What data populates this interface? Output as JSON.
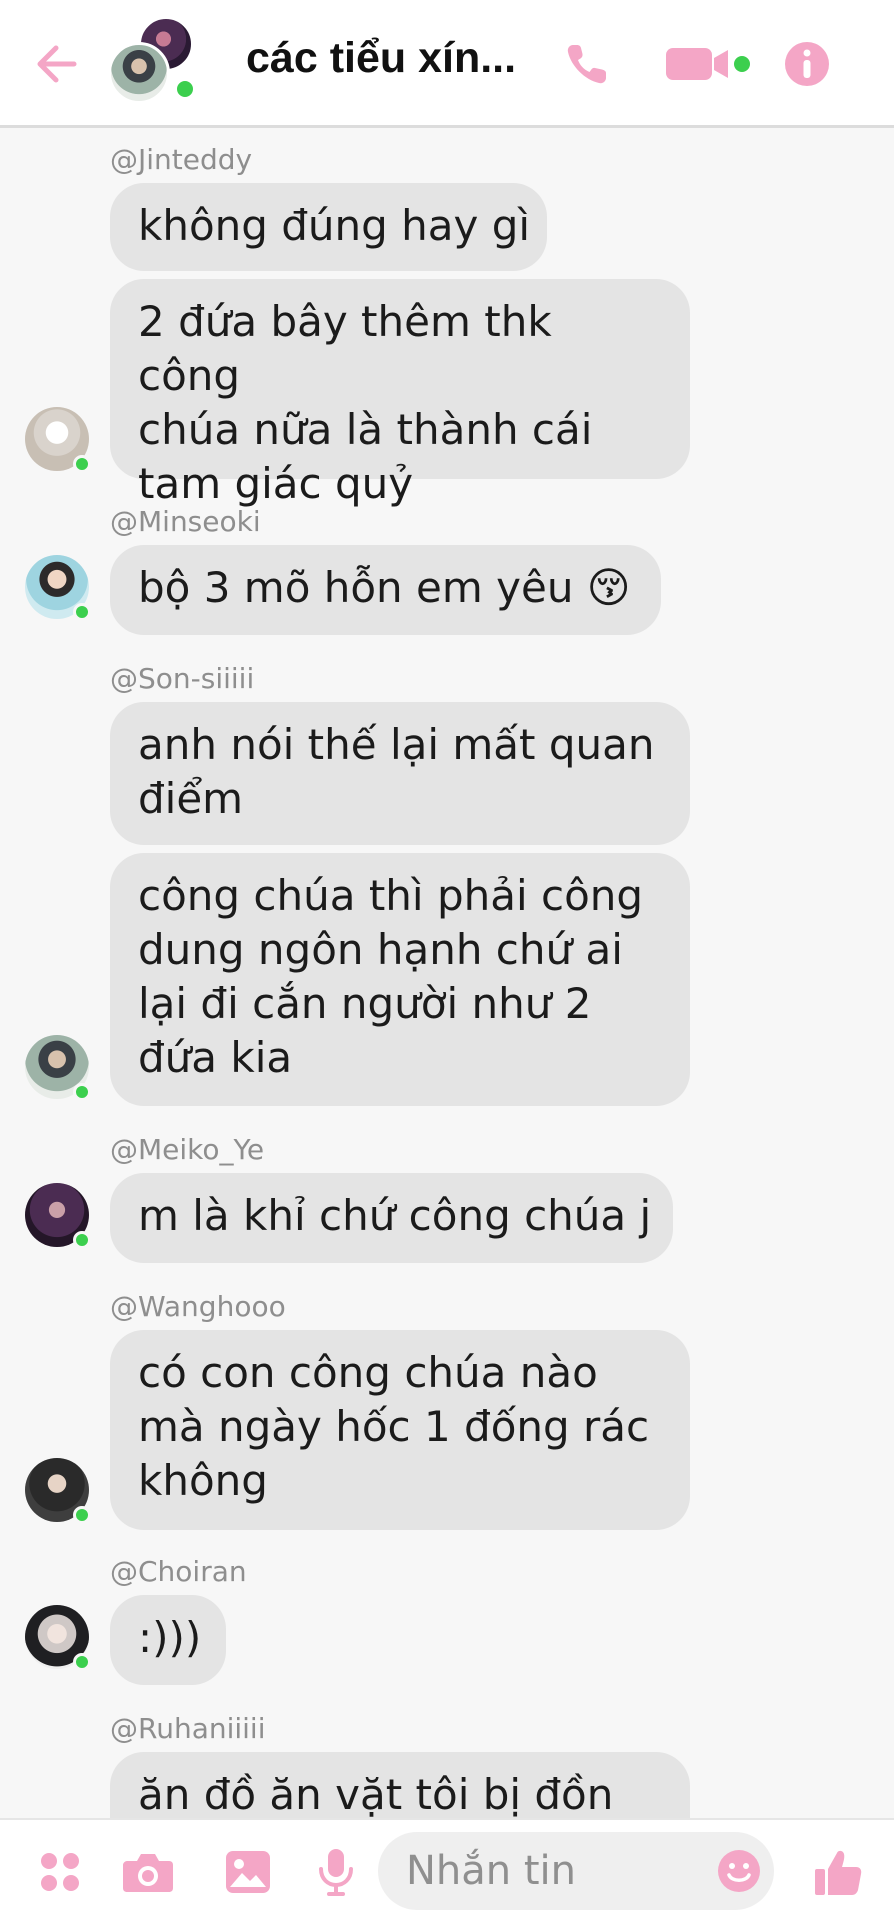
{
  "header": {
    "title": "các tiểu xín..."
  },
  "colors": {
    "accent": "#f4a6c6",
    "online": "#3ccf4e",
    "bubble": "#e4e4e4"
  },
  "messages": [
    {
      "sender": "@Jinteddy",
      "bubbles": [
        "không đúng hay gì",
        "2 đứa bây thêm thk công\nchúa nữa là thành cái\ntam giác quỷ"
      ]
    },
    {
      "sender": "@Minseoki",
      "bubbles": [
        "bộ 3 mõ hỗn em yêu 😚"
      ]
    },
    {
      "sender": "@Son-siiiii",
      "bubbles": [
        "anh nói thế lại mất quan\nđiểm",
        "công chúa thì phải công\ndung ngôn hạnh chứ ai\nlại đi cắn người như 2\nđứa kia"
      ]
    },
    {
      "sender": "@Meiko_Ye",
      "bubbles": [
        "m là khỉ chứ công chúa j"
      ]
    },
    {
      "sender": "@Wanghooo",
      "bubbles": [
        "có con công chúa nào\nmà ngày hốc 1 đống rác\nkhông"
      ]
    },
    {
      "sender": "@Choiran",
      "bubbles": [
        ":)))"
      ]
    },
    {
      "sender": "@Ruhaniiiii",
      "bubbles": [
        "ăn đồ ăn vặt tôi bị đồn"
      ]
    }
  ],
  "composer": {
    "placeholder": "Nhắn tin"
  },
  "icons": {
    "back": "arrow-left-icon",
    "phone": "phone-icon",
    "video": "video-camera-icon",
    "info": "info-icon",
    "apps": "apps-grid-icon",
    "camera": "camera-icon",
    "image": "image-icon",
    "mic": "microphone-icon",
    "emoji": "smiley-icon",
    "like": "thumbs-up-icon"
  }
}
